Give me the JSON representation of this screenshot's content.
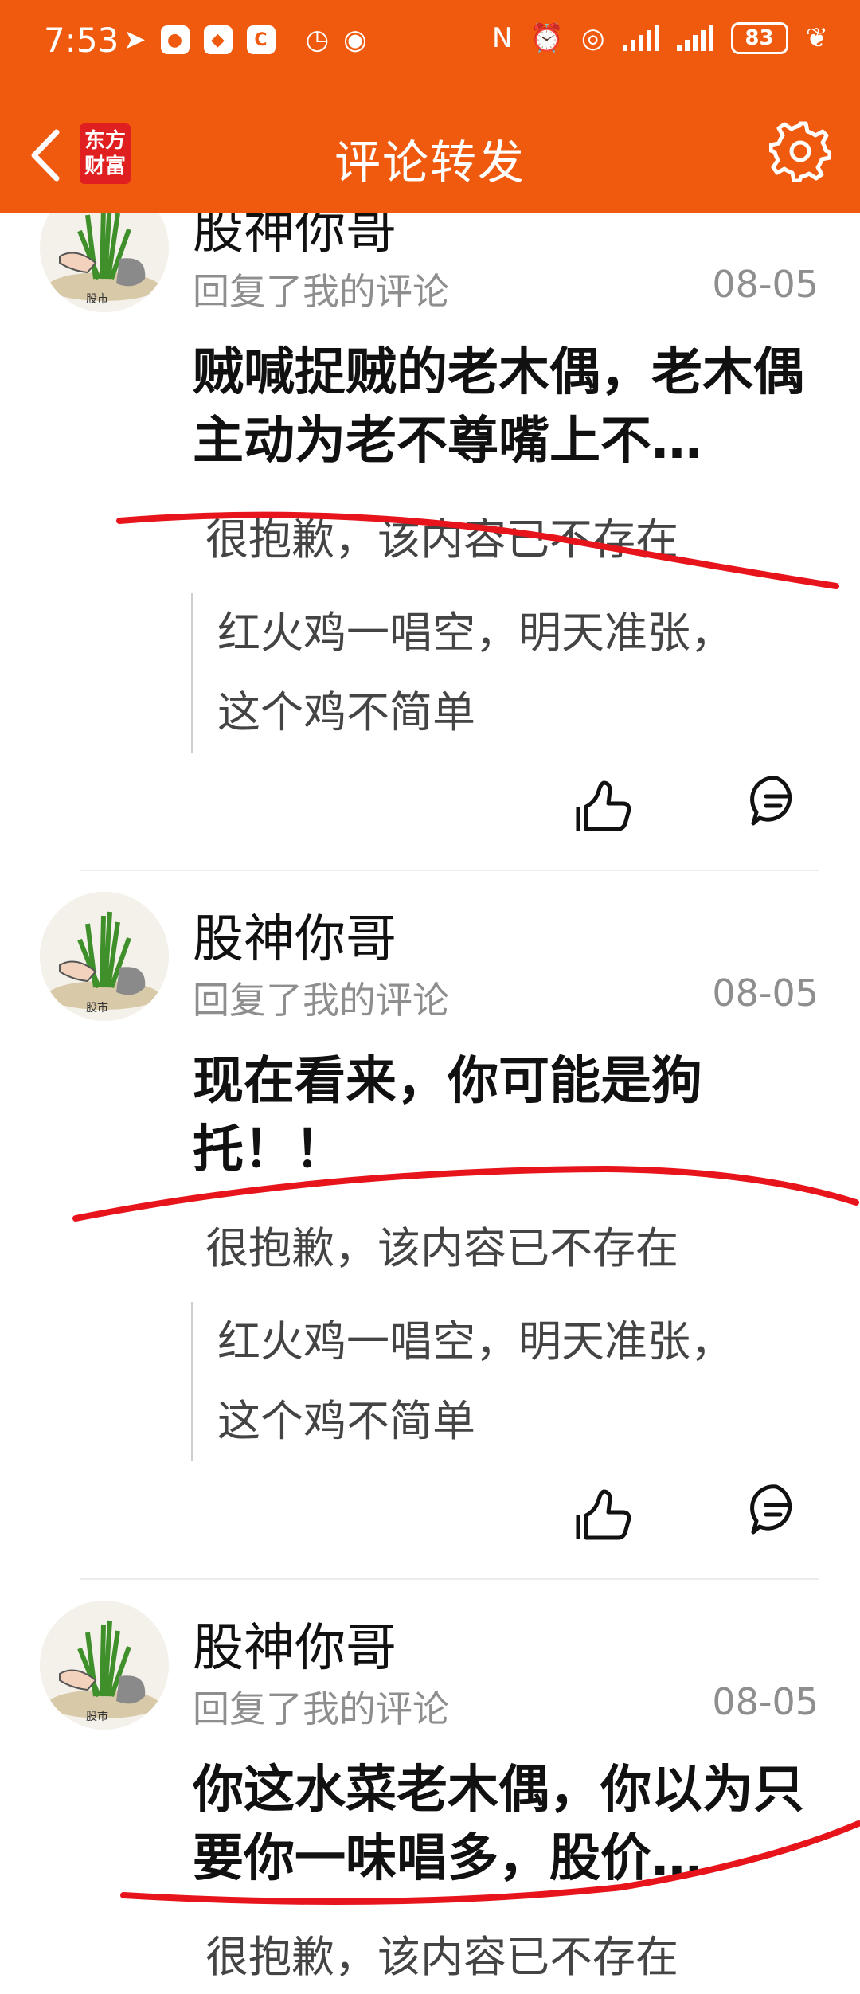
{
  "status_bar": {
    "time": "7:53",
    "battery": "83"
  },
  "header": {
    "logo_line1": "东方",
    "logo_line2": "财富",
    "title": "评论转发"
  },
  "comments": [
    {
      "username": "股神你哥",
      "subtitle": "回复了我的评论",
      "date": "08-05",
      "content": "贼喊捉贼的老木偶，老木偶主动为老不尊嘴上不…",
      "removed_text": "很抱歉，该内容已不存在",
      "quote": "红火鸡一唱空，明天准张，这个鸡不简单"
    },
    {
      "username": "股神你哥",
      "subtitle": "回复了我的评论",
      "date": "08-05",
      "content": "现在看来，你可能是狗托！！",
      "removed_text": "很抱歉，该内容已不存在",
      "quote": "红火鸡一唱空，明天准张，这个鸡不简单"
    },
    {
      "username": "股神你哥",
      "subtitle": "回复了我的评论",
      "date": "08-05",
      "content": "你这水菜老木偶，你以为只要你一味唱多，股价…",
      "removed_text": "很抱歉，该内容已不存在"
    }
  ],
  "colors": {
    "header_bg": "#f05a0e",
    "annotation_red": "#e8141b"
  }
}
